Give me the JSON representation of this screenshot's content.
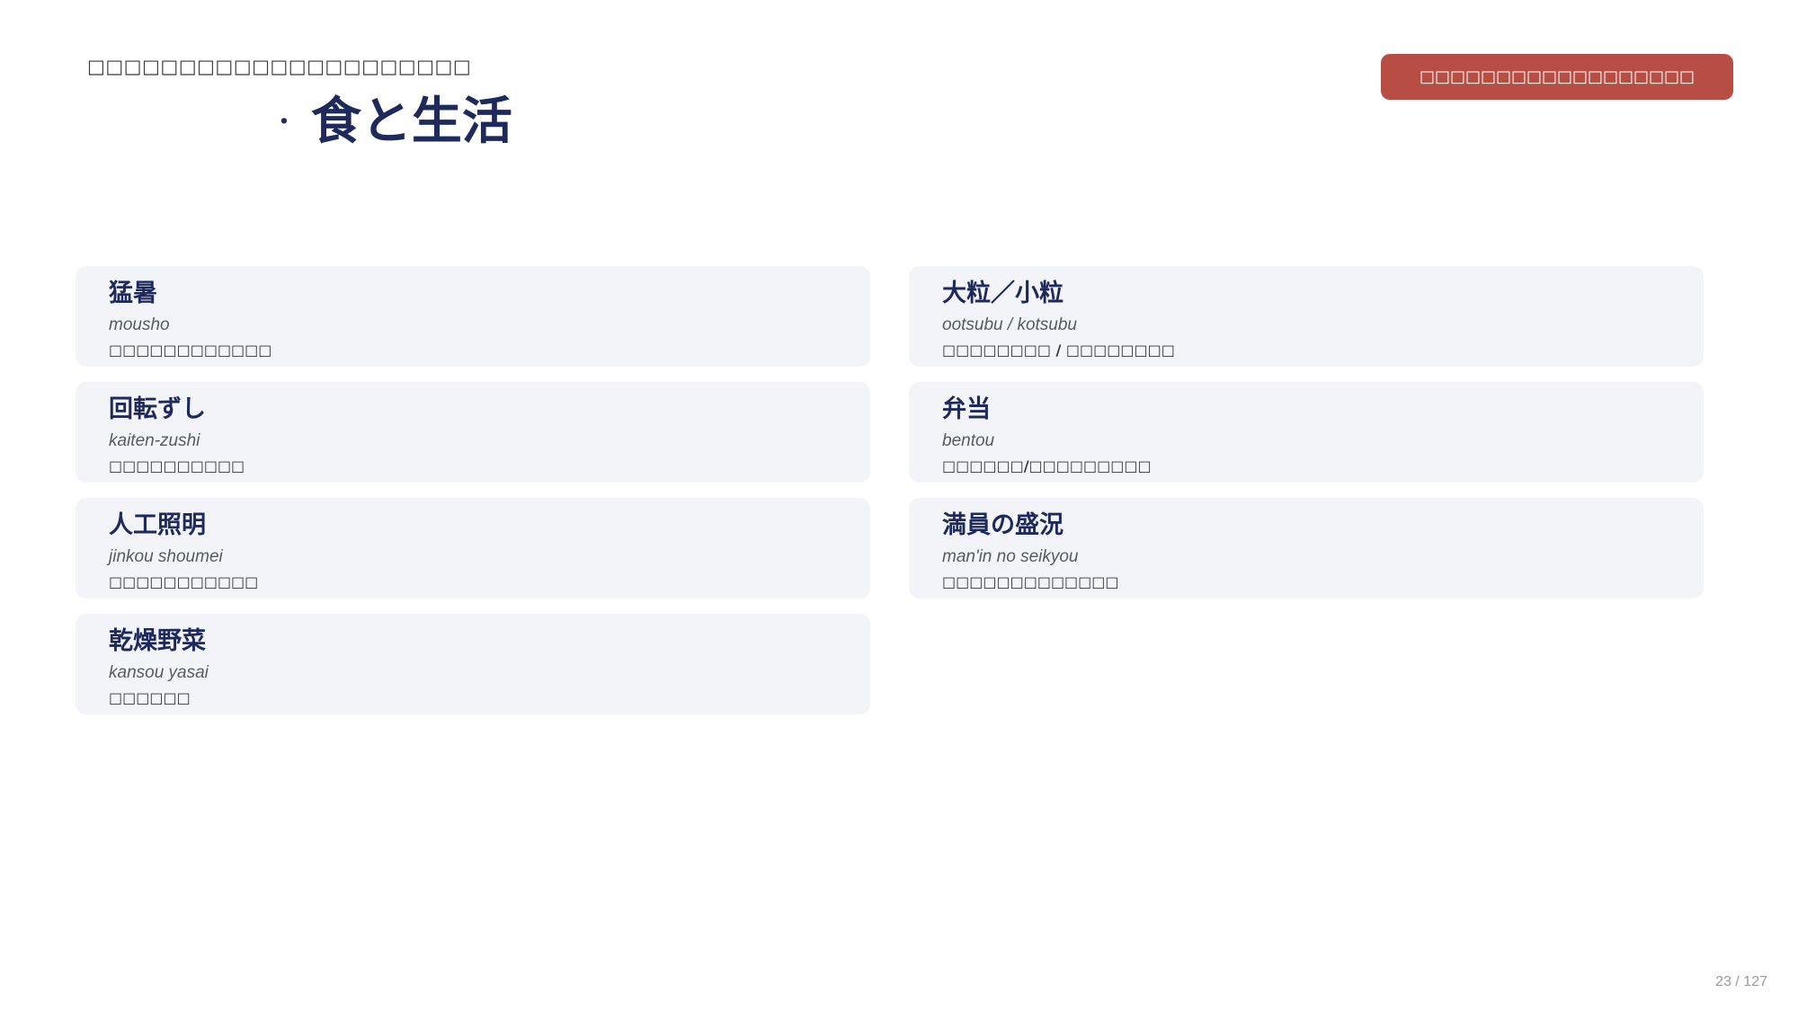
{
  "header": {
    "eyebrow": "□□□□□□□□□□□□□□□□□□□□□",
    "title_dot": "·",
    "title": "食と生活",
    "badge": "□□□□□□□□□□□□□□□□□□"
  },
  "cards": [
    {
      "term": "猛暑",
      "reading": "mousho",
      "meaning": "□□□□□□□□□□□□"
    },
    {
      "term": "大粒／小粒",
      "reading": "ootsubu / kotsubu",
      "meaning": "□□□□□□□□ / □□□□□□□□"
    },
    {
      "term": "回転ずし",
      "reading": "kaiten-zushi",
      "meaning": "□□□□□□□□□□"
    },
    {
      "term": "弁当",
      "reading": "bentou",
      "meaning": "□□□□□□/□□□□□□□□□"
    },
    {
      "term": "人工照明",
      "reading": "jinkou shoumei",
      "meaning": "□□□□□□□□□□□"
    },
    {
      "term": "満員の盛況",
      "reading": "man'in no seikyou",
      "meaning": "□□□□□□□□□□□□□"
    },
    {
      "term": "乾燥野菜",
      "reading": "kansou yasai",
      "meaning": "□□□□□□"
    }
  ],
  "footer": {
    "page_indicator": "23 / 127"
  },
  "colors": {
    "title": "#1f2a5c",
    "badge": "#b84e43",
    "card_bg": "#f3f4f8"
  }
}
